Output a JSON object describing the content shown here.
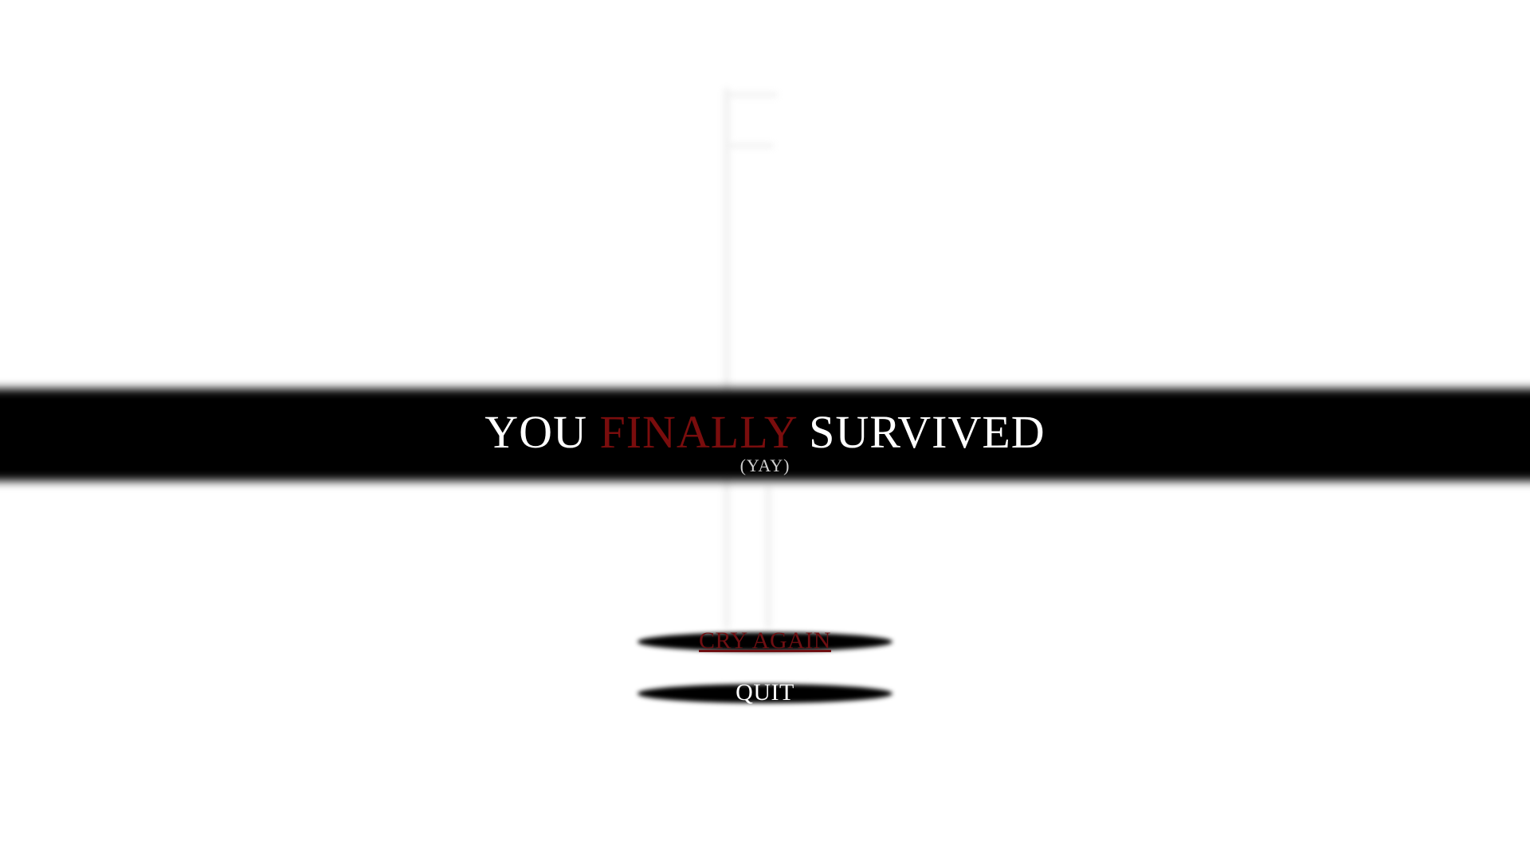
{
  "end_screen": {
    "headline": {
      "word_1": "YOU",
      "word_2": "FINALLY",
      "word_3": "SURVIVED"
    },
    "subtitle": "(YAY)"
  },
  "menu": {
    "retry_label": "CRY AGAIN",
    "quit_label": "QUIT"
  },
  "colors": {
    "background": "#ffffff",
    "banner": "#000000",
    "accent_red": "#7a0d0d",
    "text_white": "#ffffff"
  }
}
